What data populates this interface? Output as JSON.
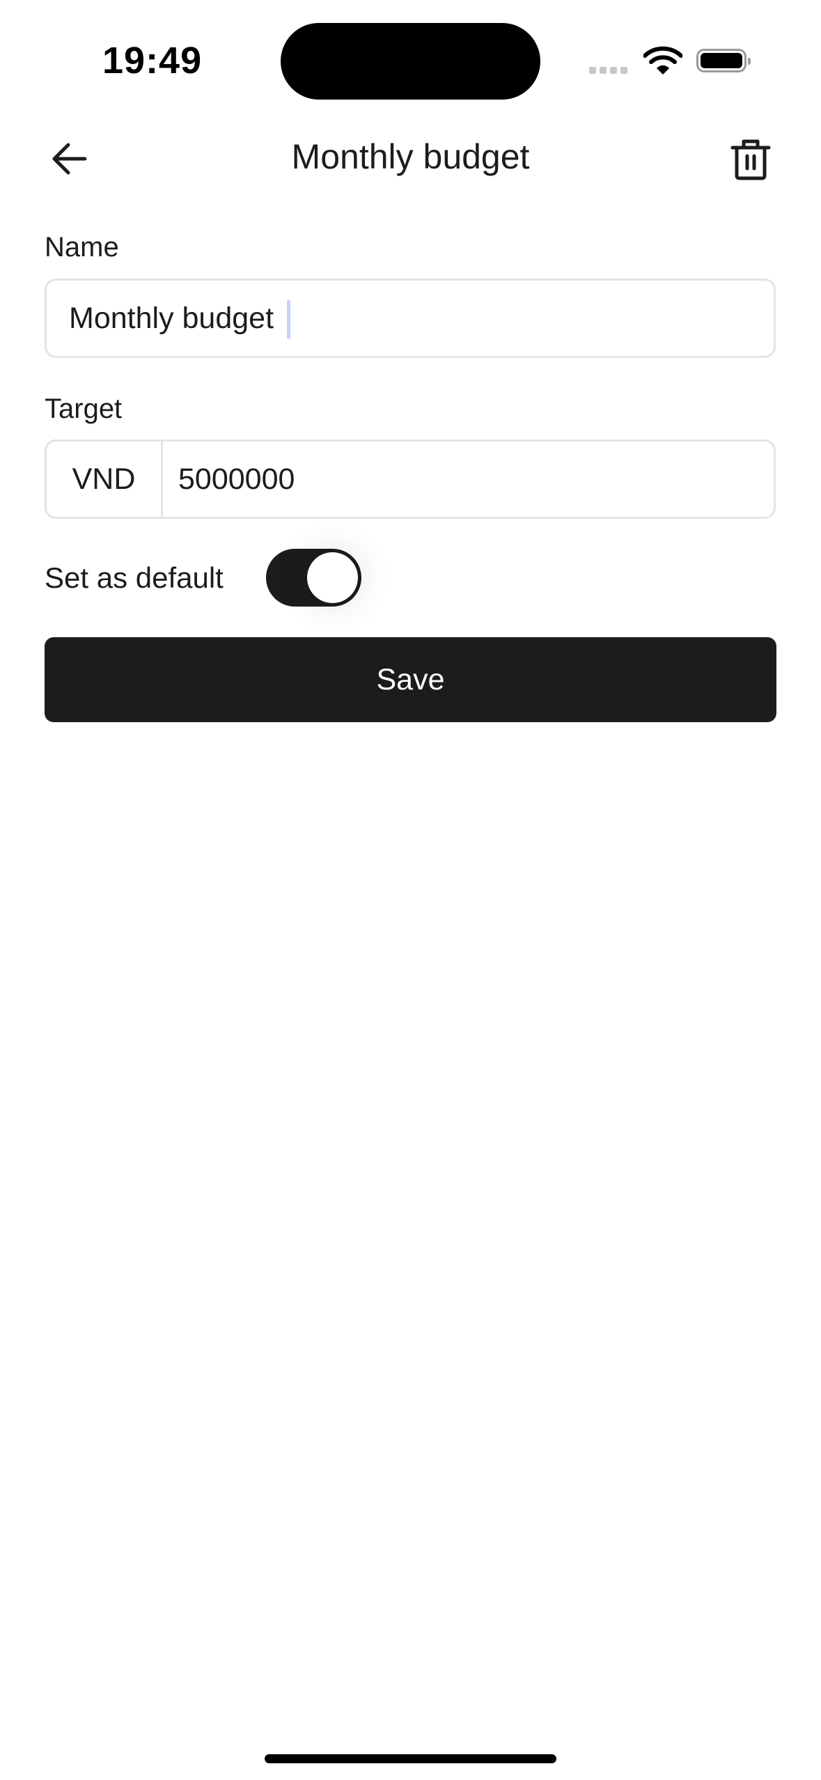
{
  "status_bar": {
    "time": "19:49",
    "icons": [
      "signal-icon",
      "wifi-icon",
      "battery-icon"
    ]
  },
  "header": {
    "title": "Monthly budget",
    "back_icon": "arrow-left-icon",
    "delete_icon": "trash-icon"
  },
  "form": {
    "name": {
      "label": "Name",
      "value": "Monthly budget"
    },
    "target": {
      "label": "Target",
      "currency": "VND",
      "value": "5000000"
    },
    "default": {
      "label": "Set as default",
      "enabled": true
    }
  },
  "save_label": "Save",
  "colors": {
    "primary": "#1c1c1e",
    "border": "#e4e4e7",
    "cursor": "#c7d2fe"
  }
}
